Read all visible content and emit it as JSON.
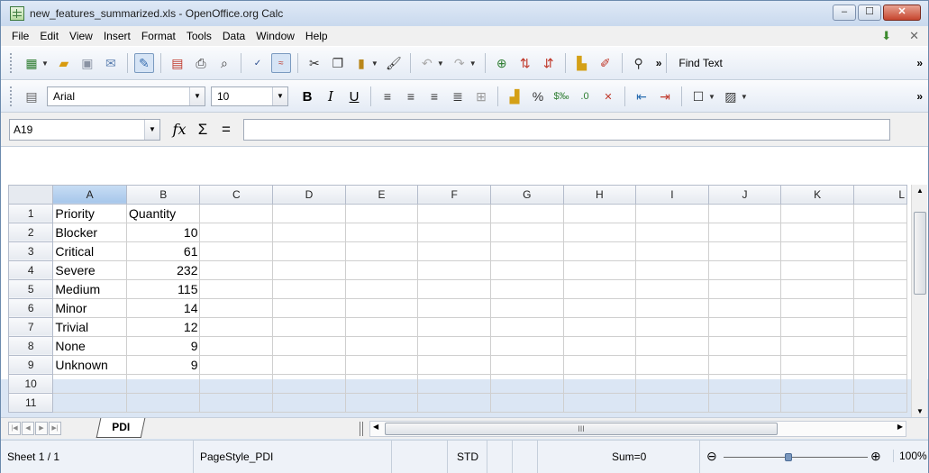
{
  "window": {
    "title": "new_features_summarized.xls - OpenOffice.org Calc",
    "controls": {
      "minimize": "‒",
      "maximize": "☐",
      "close": "✕"
    }
  },
  "menu": {
    "items": [
      {
        "label": "File"
      },
      {
        "label": "Edit"
      },
      {
        "label": "View"
      },
      {
        "label": "Insert"
      },
      {
        "label": "Format"
      },
      {
        "label": "Tools"
      },
      {
        "label": "Data"
      },
      {
        "label": "Window"
      },
      {
        "label": "Help"
      }
    ],
    "close_doc": "✕"
  },
  "toolbar": {
    "find_text": "Find Text",
    "overflow": "»"
  },
  "format_toolbar": {
    "font_name": "Arial",
    "font_size": "10",
    "bold": "B",
    "italic": "I",
    "underline": "U",
    "percent": "%",
    "overflow": "»"
  },
  "formula_bar": {
    "name_box": "A19",
    "fx": "fx",
    "sigma": "Σ",
    "equals": "=",
    "formula": ""
  },
  "sheet": {
    "columns": [
      "A",
      "B",
      "C",
      "D",
      "E",
      "F",
      "G",
      "H",
      "I",
      "J",
      "K",
      "L"
    ],
    "rows": [
      {
        "num": "1",
        "a": "Priority",
        "b": "Quantity"
      },
      {
        "num": "2",
        "a": "Blocker",
        "b": "10"
      },
      {
        "num": "3",
        "a": "Critical",
        "b": "61"
      },
      {
        "num": "4",
        "a": "Severe",
        "b": "232"
      },
      {
        "num": "5",
        "a": "Medium",
        "b": "115"
      },
      {
        "num": "6",
        "a": "Minor",
        "b": "14"
      },
      {
        "num": "7",
        "a": "Trivial",
        "b": "12"
      },
      {
        "num": "8",
        "a": "None",
        "b": "9"
      },
      {
        "num": "9",
        "a": "Unknown",
        "b": "9"
      },
      {
        "num": "10",
        "a": "",
        "b": ""
      },
      {
        "num": "11",
        "a": "",
        "b": ""
      }
    ]
  },
  "tabs": {
    "active": "PDI"
  },
  "hscroll": {
    "grip": "III"
  },
  "status": {
    "sheet": "Sheet 1 / 1",
    "page_style": "PageStyle_PDI",
    "mode": "STD",
    "sum": "Sum=0",
    "zoom_out": "⊖",
    "zoom_in": "⊕",
    "zoom": "100%"
  }
}
